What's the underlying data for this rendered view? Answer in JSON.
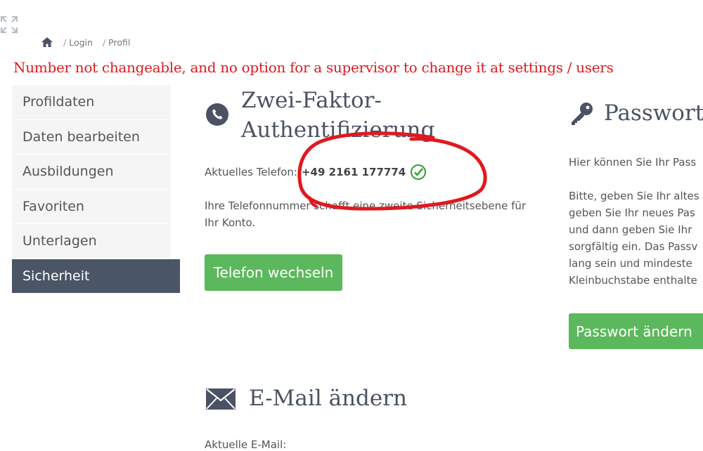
{
  "breadcrumb": {
    "items": [
      "Login",
      "Profil"
    ],
    "separator": "/"
  },
  "annotation": "Number not changeable, and no option for a supervisor to change it at settings / users",
  "sidebar": {
    "items": [
      {
        "label": "Profildaten"
      },
      {
        "label": "Daten bearbeiten"
      },
      {
        "label": "Ausbildungen"
      },
      {
        "label": "Favoriten"
      },
      {
        "label": "Unterlagen"
      },
      {
        "label": "Sicherheit",
        "active": true
      }
    ]
  },
  "two_factor": {
    "title_line1": "Zwei-Faktor-",
    "title_line2": "Authentifizierung",
    "current_label": "Aktuelles Telefon:",
    "phone_number": "+49 2161 177774",
    "description": "Ihre Telefonnummer schafft eine zweite Sicherheitsebene für Ihr Konto.",
    "button": "Telefon wechseln"
  },
  "password": {
    "title": "Passwort",
    "intro": "Hier können Sie Ihr Pass",
    "lines": [
      "Bitte, geben Sie Ihr altes",
      "geben Sie Ihr neues Pas",
      "und dann geben Sie Ihr",
      "sorgfältig ein. Das Passv",
      "lang sein und mindeste",
      "Kleinbuchstabe enthalte"
    ],
    "button": "Passwort ändern"
  },
  "email": {
    "title": "E-Mail ändern",
    "current_label": "Aktuelle E-Mail:"
  },
  "colors": {
    "accent_green": "#5cb85c",
    "sidebar_active": "#4a5566",
    "annotation_red": "#e0191f",
    "heading": "#4a5263"
  },
  "icons": [
    "expand-icon",
    "home-icon",
    "phone-icon",
    "check-circle-icon",
    "key-icon",
    "envelope-icon"
  ]
}
